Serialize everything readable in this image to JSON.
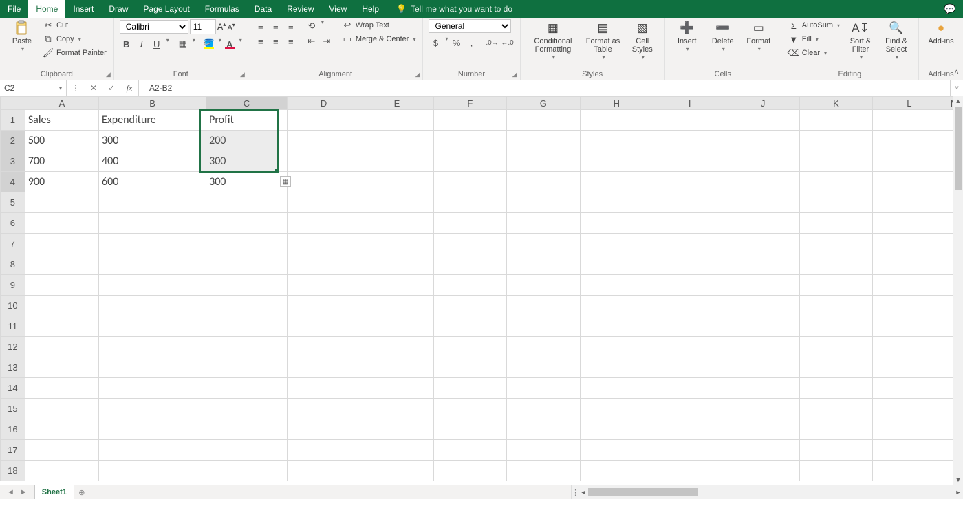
{
  "tabs": {
    "file": "File",
    "home": "Home",
    "insert": "Insert",
    "draw": "Draw",
    "page_layout": "Page Layout",
    "formulas": "Formulas",
    "data": "Data",
    "review": "Review",
    "view": "View",
    "help": "Help",
    "tellme": "Tell me what you want to do"
  },
  "ribbon": {
    "clipboard": {
      "paste": "Paste",
      "cut": "Cut",
      "copy": "Copy",
      "painter": "Format Painter",
      "label": "Clipboard"
    },
    "font": {
      "name": "Calibri",
      "size": "11",
      "bold": "B",
      "italic": "I",
      "underline": "U",
      "label": "Font"
    },
    "alignment": {
      "wrap": "Wrap Text",
      "merge": "Merge & Center",
      "label": "Alignment"
    },
    "number": {
      "format": "General",
      "label": "Number"
    },
    "styles": {
      "cond": "Conditional Formatting",
      "table": "Format as Table",
      "cell": "Cell Styles",
      "label": "Styles"
    },
    "cells": {
      "insert": "Insert",
      "delete": "Delete",
      "format": "Format",
      "label": "Cells"
    },
    "editing": {
      "sum": "AutoSum",
      "fill": "Fill",
      "clear": "Clear",
      "sort": "Sort & Filter",
      "find": "Find & Select",
      "label": "Editing"
    },
    "addins": {
      "get": "Add-ins",
      "label": "Add-ins"
    }
  },
  "namebox": "C2",
  "formula": "=A2-B2",
  "columns": [
    "A",
    "B",
    "C",
    "D",
    "E",
    "F",
    "G",
    "H",
    "I",
    "J",
    "K",
    "L",
    "M"
  ],
  "rows": 18,
  "data": {
    "A1": "Sales",
    "B1": "Expenditure",
    "C1": "Profit",
    "A2": "500",
    "B2": "300",
    "C2": "200",
    "A3": "700",
    "B3": "400",
    "C3": "300",
    "A4": "900",
    "B4": "600",
    "C4": "300"
  },
  "bold_cells": [
    "A1",
    "B1",
    "C1"
  ],
  "sheet": {
    "name": "Sheet1"
  }
}
